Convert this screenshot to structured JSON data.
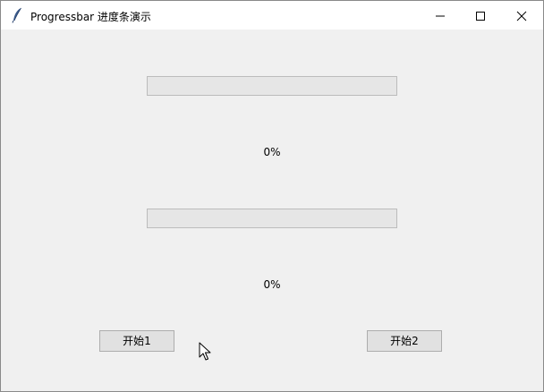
{
  "window": {
    "title": "Progressbar 进度条演示",
    "app_icon": "feather-icon",
    "controls": {
      "minimize": "minimize-icon",
      "maximize": "maximize-icon",
      "close": "close-icon"
    }
  },
  "progress1": {
    "value": 0,
    "label": "0%"
  },
  "progress2": {
    "value": 0,
    "label": "0%"
  },
  "buttons": {
    "start1": "开始1",
    "start2": "开始2"
  },
  "colors": {
    "background": "#f0f0f0",
    "titlebar": "#ffffff",
    "progress_trough": "#e6e6e6",
    "progress_fill": "#06b025",
    "button_face": "#e1e1e1"
  }
}
